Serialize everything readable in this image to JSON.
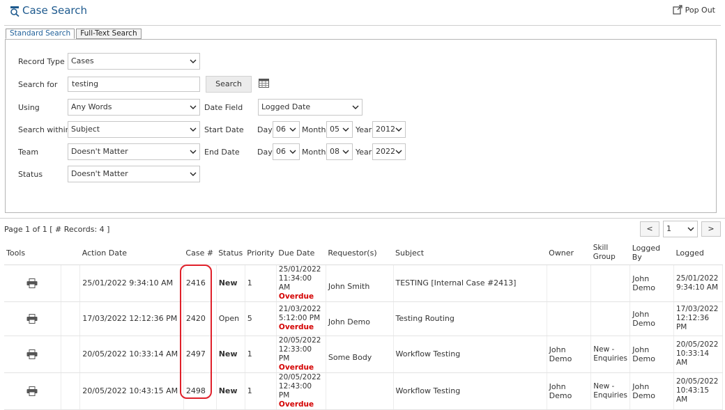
{
  "header": {
    "title": "Case Search",
    "popout_label": "Pop Out"
  },
  "tabs": [
    "Standard Search",
    "Full-Text Search"
  ],
  "form": {
    "record_type": {
      "label": "Record Type",
      "value": "Cases"
    },
    "search_for": {
      "label": "Search for",
      "value": "testing",
      "button": "Search"
    },
    "using": {
      "label": "Using",
      "value": "Any Words"
    },
    "search_within": {
      "label": "Search within",
      "value": "Subject"
    },
    "team": {
      "label": "Team",
      "value": "Doesn't Matter"
    },
    "status": {
      "label": "Status",
      "value": "Doesn't Matter"
    },
    "date_field": {
      "label": "Date Field",
      "value": "Logged Date"
    },
    "start_date": {
      "label": "Start Date",
      "day": "06",
      "month": "05",
      "year": "2012"
    },
    "end_date": {
      "label": "End Date",
      "day": "06",
      "month": "08",
      "year": "2022"
    },
    "day_label": "Day",
    "month_label": "Month",
    "year_label": "Year"
  },
  "pager": {
    "info": "Page 1 of 1 [ # Records: 4 ]",
    "prev": "<",
    "next": ">",
    "page": "1"
  },
  "table": {
    "headers": {
      "tools": "Tools",
      "action_date": "Action Date",
      "case": "Case #",
      "status": "Status",
      "priority": "Priority",
      "due_date": "Due Date",
      "requestor": "Requestor(s)",
      "subject": "Subject",
      "owner": "Owner",
      "skill_group": "Skill Group",
      "logged_by": "Logged By",
      "logged": "Logged"
    },
    "rows": [
      {
        "action_date": "25/01/2022 9:34:10 AM",
        "case": "2416",
        "status": "New",
        "priority": "1",
        "due_date": "25/01/2022 11:34:00 AM",
        "due_flag": "Overdue",
        "requestor": "John Smith",
        "subject": "TESTING [Internal Case #2413]",
        "owner": "",
        "skill_group": "",
        "logged_by": "John Demo",
        "logged": "25/01/2022 9:34:10 AM"
      },
      {
        "action_date": "17/03/2022 12:12:36 PM",
        "case": "2420",
        "status": "Open",
        "priority": "5",
        "due_date": "21/03/2022 5:12:00 PM",
        "due_flag": "Overdue",
        "requestor": "John Demo",
        "subject": "Testing Routing",
        "owner": "",
        "skill_group": "",
        "logged_by": "John Demo",
        "logged": "17/03/2022 12:12:36 PM"
      },
      {
        "action_date": "20/05/2022 10:33:14 AM",
        "case": "2497",
        "status": "New",
        "priority": "1",
        "due_date": "20/05/2022 12:33:00 PM",
        "due_flag": "Overdue",
        "requestor": "Some Body",
        "subject": "Workflow Testing",
        "owner": "John Demo",
        "skill_group": "New - Enquiries",
        "logged_by": "John Demo",
        "logged": "20/05/2022 10:33:14 AM"
      },
      {
        "action_date": "20/05/2022 10:43:15 AM",
        "case": "2498",
        "status": "New",
        "priority": "1",
        "due_date": "20/05/2022 12:43:00 PM",
        "due_flag": "Overdue",
        "requestor": "",
        "subject": "Workflow Testing",
        "owner": "John Demo",
        "skill_group": "New - Enquiries",
        "logged_by": "John Demo",
        "logged": "20/05/2022 10:43:15 AM"
      }
    ]
  },
  "colors": {
    "title": "#1e5a8e",
    "overdue": "#d40000",
    "annotation": "#e0202a"
  },
  "icons": {
    "title": "search-icon",
    "popout": "popout-icon",
    "calendar": "calendar-icon",
    "row_tool": "printer-icon",
    "dropdown": "chevron-down-icon"
  }
}
